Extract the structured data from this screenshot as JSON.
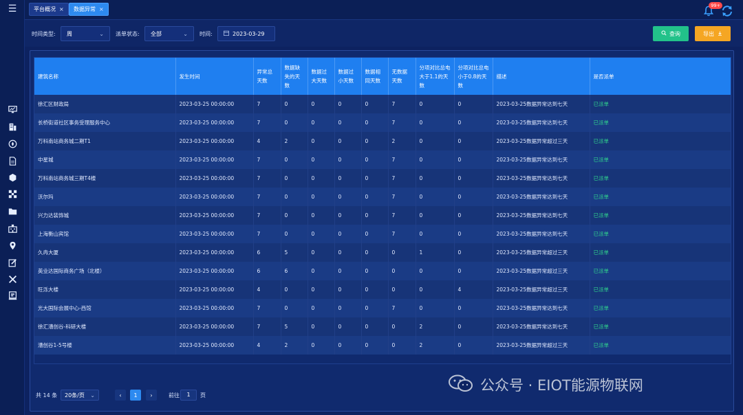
{
  "tabs": [
    {
      "label": "平台概况",
      "close": "×"
    },
    {
      "label": "数据异常",
      "close": "×"
    }
  ],
  "header": {
    "notification_count": "99+"
  },
  "filters": {
    "time_type_label": "时间类型:",
    "time_type_value": "周",
    "dispatch_label": "派单状态:",
    "dispatch_value": "全部",
    "time_label": "时间:",
    "time_value": "2023-03-29",
    "query_label": "查询",
    "export_label": "导出"
  },
  "table": {
    "columns": [
      "建筑名称",
      "发生时间",
      "异常总天数",
      "数据缺失的天数",
      "数据过大天数",
      "数据过小天数",
      "数据相同天数",
      "无数据天数",
      "分项对比总电大于1.1的天数",
      "分项对比总电小于0.8的天数",
      "描述",
      "是否派单"
    ],
    "rows": [
      [
        "徐汇区财政局",
        "2023-03-25 00:00:00",
        "7",
        "0",
        "0",
        "0",
        "0",
        "7",
        "0",
        "0",
        "2023-03-25数据异常达到七天",
        "已派单"
      ],
      [
        "长桥街道社区事务受理服务中心",
        "2023-03-25 00:00:00",
        "7",
        "0",
        "0",
        "0",
        "0",
        "7",
        "0",
        "0",
        "2023-03-25数据异常达到七天",
        "已派单"
      ],
      [
        "万科南站商务城二期T1",
        "2023-03-25 00:00:00",
        "4",
        "2",
        "0",
        "0",
        "0",
        "2",
        "0",
        "0",
        "2023-03-25数据异常超过三天",
        "已派单"
      ],
      [
        "中星城",
        "2023-03-25 00:00:00",
        "7",
        "0",
        "0",
        "0",
        "0",
        "7",
        "0",
        "0",
        "2023-03-25数据异常达到七天",
        "已派单"
      ],
      [
        "万科南站商务城三期T4楼",
        "2023-03-25 00:00:00",
        "7",
        "0",
        "0",
        "0",
        "0",
        "7",
        "0",
        "0",
        "2023-03-25数据异常达到七天",
        "已派单"
      ],
      [
        "沃尔玛",
        "2023-03-25 00:00:00",
        "7",
        "0",
        "0",
        "0",
        "0",
        "7",
        "0",
        "0",
        "2023-03-25数据异常达到七天",
        "已派单"
      ],
      [
        "兴力达装饰城",
        "2023-03-25 00:00:00",
        "7",
        "0",
        "0",
        "0",
        "0",
        "7",
        "0",
        "0",
        "2023-03-25数据异常达到七天",
        "已派单"
      ],
      [
        "上海衡山宾馆",
        "2023-03-25 00:00:00",
        "7",
        "0",
        "0",
        "0",
        "0",
        "7",
        "0",
        "0",
        "2023-03-25数据异常达到七天",
        "已派单"
      ],
      [
        "久冉大厦",
        "2023-03-25 00:00:00",
        "6",
        "5",
        "0",
        "0",
        "0",
        "0",
        "1",
        "0",
        "2023-03-25数据异常超过三天",
        "已派单"
      ],
      [
        "英业达国际商务广场（北楼）",
        "2023-03-25 00:00:00",
        "6",
        "6",
        "0",
        "0",
        "0",
        "0",
        "0",
        "0",
        "2023-03-25数据异常超过三天",
        "已派单"
      ],
      [
        "旺泺大楼",
        "2023-03-25 00:00:00",
        "4",
        "0",
        "0",
        "0",
        "0",
        "0",
        "0",
        "4",
        "2023-03-25数据异常超过三天",
        "已派单"
      ],
      [
        "光大国际会展中心-西馆",
        "2023-03-25 00:00:00",
        "7",
        "0",
        "0",
        "0",
        "0",
        "7",
        "0",
        "0",
        "2023-03-25数据异常达到七天",
        "已派单"
      ],
      [
        "徐汇漕创谷-科研大楼",
        "2023-03-25 00:00:00",
        "7",
        "5",
        "0",
        "0",
        "0",
        "0",
        "2",
        "0",
        "2023-03-25数据异常达到七天",
        "已派单"
      ],
      [
        "漕创谷1-5号楼",
        "2023-03-25 00:00:00",
        "4",
        "2",
        "0",
        "0",
        "0",
        "0",
        "2",
        "0",
        "2023-03-25数据异常超过三天",
        "已派单"
      ]
    ]
  },
  "pagination": {
    "total": "共 14 条",
    "page_size": "20条/页",
    "current_page": "1",
    "goto_label": "前往",
    "goto_value": "1",
    "page_unit": "页"
  },
  "watermark": {
    "text": "公众号 · EIOT能源物联网"
  },
  "colors": {
    "accent": "#1f7ff0",
    "query_button": "#22c28a",
    "export_button": "#f5a623",
    "status_green": "#2fd18d",
    "badge_red": "#ff4a4a"
  }
}
